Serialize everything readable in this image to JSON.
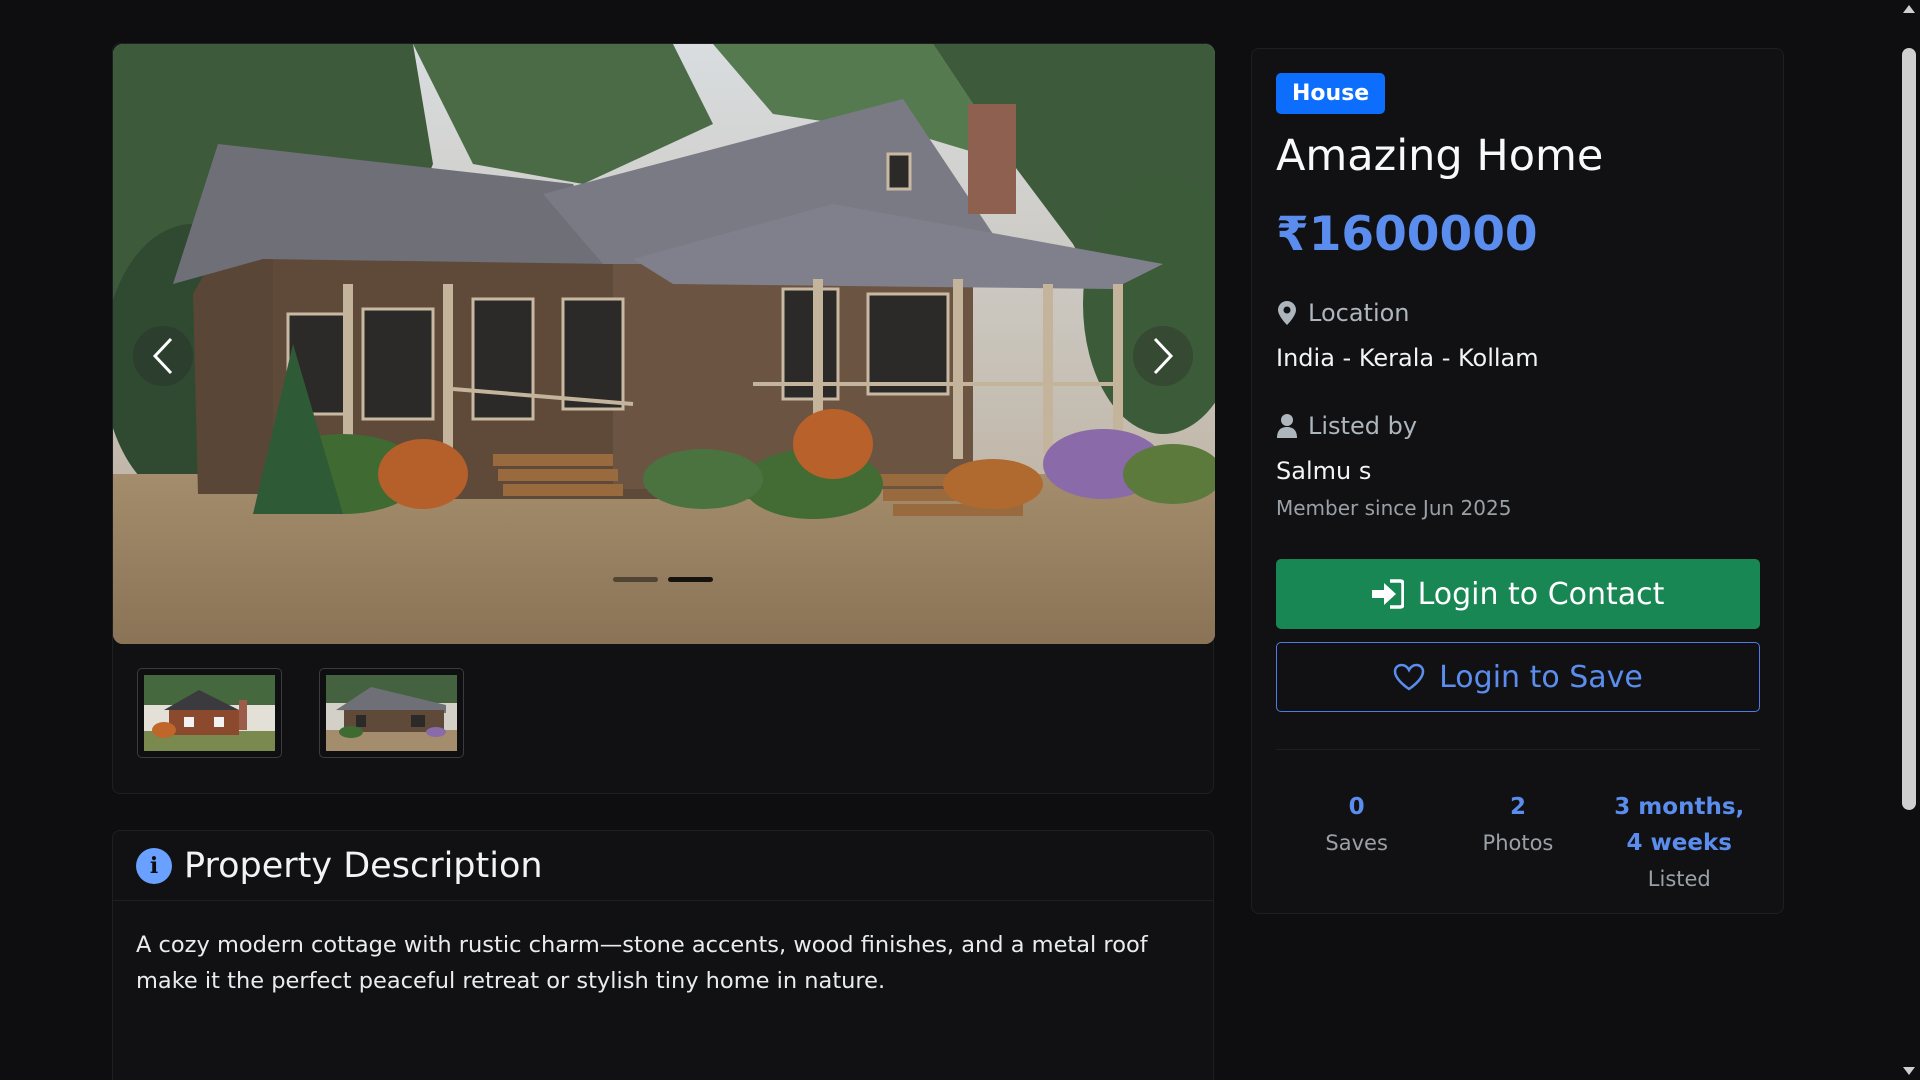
{
  "gallery": {
    "prev_icon": "chevron-left-icon",
    "next_icon": "chevron-right-icon",
    "slide_count": 2,
    "active_slide": 2
  },
  "description": {
    "icon": "info-circle-icon",
    "title": "Property Description",
    "text": "A cozy modern cottage with rustic charm—stone accents, wood finishes, and a metal roof make it the perfect peaceful retreat or stylish tiny home in nature."
  },
  "property": {
    "badge": "House",
    "title": "Amazing Home",
    "price": "₹1600000",
    "location_label": "Location",
    "location_icon": "map-pin-icon",
    "location_value": "India - Kerala - Kollam",
    "listed_by_label": "Listed by",
    "listed_by_icon": "user-icon",
    "owner_name": "Salmu s",
    "member_since": "Member since Jun 2025"
  },
  "actions": {
    "contact_label": "Login to Contact",
    "contact_icon": "sign-in-icon",
    "save_label": "Login to Save",
    "save_icon": "heart-icon"
  },
  "stats": {
    "saves_value": "0",
    "saves_label": "Saves",
    "photos_value": "2",
    "photos_label": "Photos",
    "listed_value_line1": "3 months,",
    "listed_value_line2": "4 weeks",
    "listed_label": "Listed"
  },
  "colors": {
    "background": "#0e0e10",
    "badge": "#0d6efd",
    "price": "#5a8dee",
    "contact_button": "#198754"
  }
}
